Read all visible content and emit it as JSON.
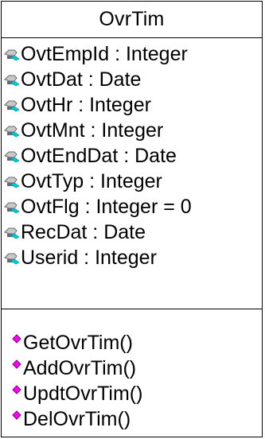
{
  "class_box": {
    "name": "OvrTim",
    "attribute_icon": "protected-attribute-key-icon",
    "operation_icon": "public-operation-diamond-icon",
    "attributes": [
      "OvtEmpId : Integer",
      "OvtDat : Date",
      "OvtHr : Integer",
      "OvtMnt : Integer",
      "OvtEndDat : Date",
      "OvtTyp : Integer",
      "OvtFlg : Integer = 0",
      "RecDat : Date",
      "Userid : Integer"
    ],
    "operations": [
      "GetOvrTim()",
      "AddOvrTim()",
      "UpdtOvrTim()",
      "DelOvrTim()"
    ]
  },
  "colors": {
    "border": "#000000",
    "text": "#000000",
    "background": "#ffffff",
    "attribute_icon_fill": "#c9c9c9",
    "attribute_icon_shadow": "#6a6a6a",
    "attribute_icon_accent": "#00c8d8",
    "operation_icon_fill": "#ff00ff",
    "operation_icon_shadow": "#7a007a"
  }
}
